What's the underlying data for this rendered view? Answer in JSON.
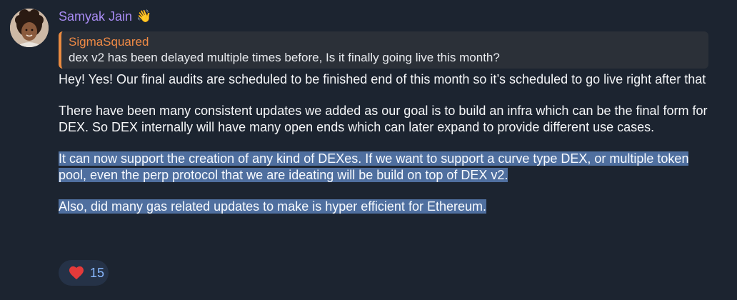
{
  "message": {
    "sender": "Samyak Jain",
    "sender_icon": "waving-hand-icon",
    "reply": {
      "author": "SigmaSquared",
      "text": "dex v2 has been delayed multiple times before, Is it finally going live this month?"
    },
    "paragraphs": [
      "Hey! Yes! Our final audits are scheduled to be finished end of this month so it’s scheduled to go live right after that",
      "There have been many consistent updates we added as our goal is to build an infra which can be the final form for DEX. So DEX internally will have many open ends which can later expand to provide different use cases.",
      "It can now support the creation of any kind of DEXes. If we want to support a curve type DEX, or multiple token pool, even the perp protocol that we are ideating will be build on top of DEX v2.",
      "Also, did many gas related updates to make is hyper efficient for Ethereum."
    ]
  },
  "reaction": {
    "icon": "heart-icon",
    "count": "15"
  },
  "colors": {
    "background": "#1c2430",
    "sender_name": "#a88bf3",
    "reply_author": "#f08a45",
    "reply_bar": "#ea8b41",
    "selection": "#4f6f9f",
    "reaction_bg": "#253247",
    "reaction_count": "#89b8ff",
    "heart": "#e43a3a"
  }
}
